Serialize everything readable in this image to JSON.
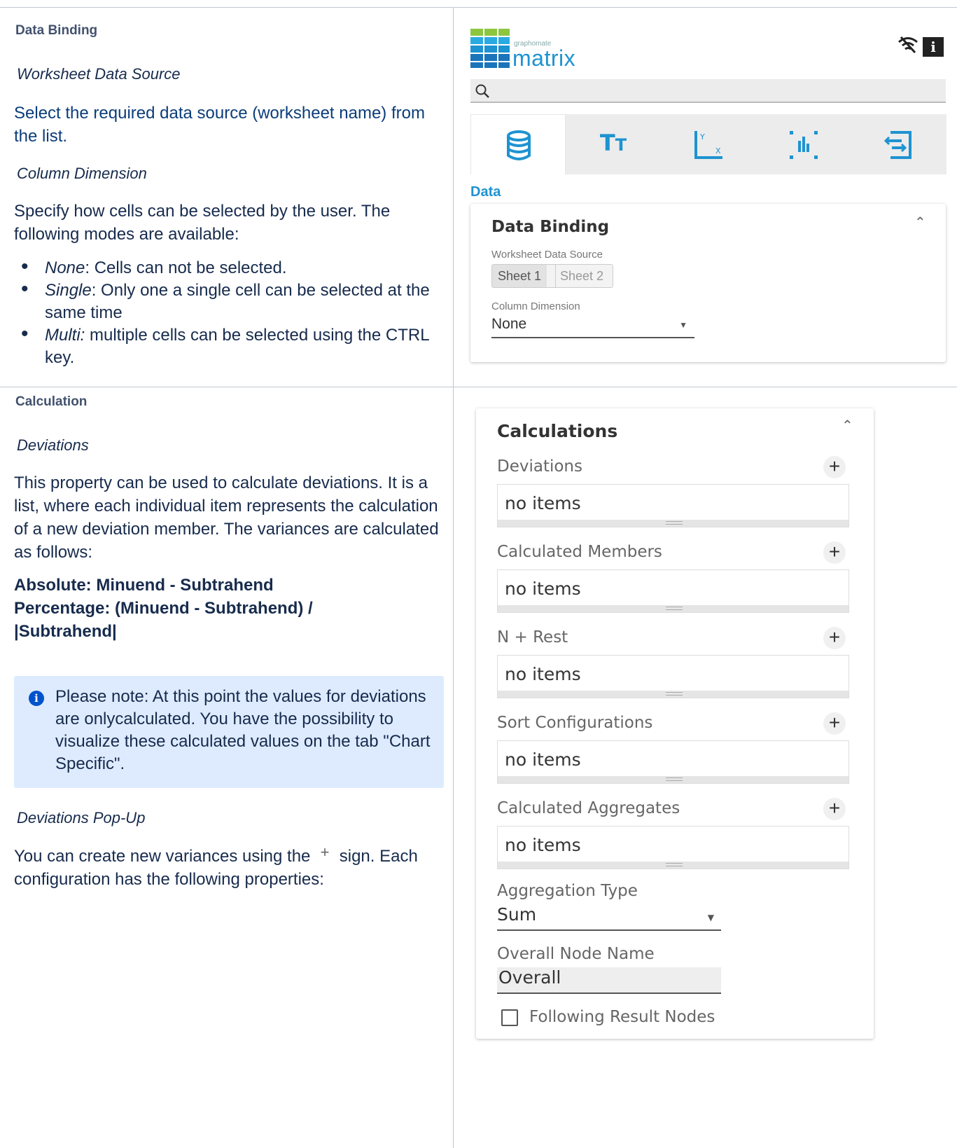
{
  "row1": {
    "left": {
      "header": "Data Binding",
      "sub1": "Worksheet Data Source",
      "para1": "Select the required data source (worksheet name) from the list.",
      "sub2": "Column Dimension",
      "para2": "Specify how cells can be selected by the user. The following modes are available:",
      "bullets": [
        {
          "term": "None",
          "sep": ":",
          "text": " Cells can not be selected."
        },
        {
          "term": "Single",
          "sep": ":",
          "text": " Only one a single cell can be selected at the same time"
        },
        {
          "term": "Multi:",
          "sep": "",
          "text": " multiple cells can be selected using the CTRL key."
        }
      ]
    },
    "right": {
      "logo_small": "graphomate",
      "logo_word": "matrix",
      "search_placeholder": "",
      "tabs": [
        {
          "icon": "database-icon",
          "glyph": "⛁"
        },
        {
          "icon": "text-size-icon",
          "glyph": "Tᴛ"
        },
        {
          "icon": "axis-icon",
          "glyph": ""
        },
        {
          "icon": "chart-bars-icon",
          "glyph": ""
        },
        {
          "icon": "export-icon",
          "glyph": ""
        }
      ],
      "section": "Data",
      "card_title": "Data Binding",
      "worksheet_label": "Worksheet Data Source",
      "sheets": [
        "Sheet 1",
        "Sheet 2"
      ],
      "column_dim_label": "Column Dimension",
      "column_dim_value": "None"
    }
  },
  "row2": {
    "left": {
      "header": "Calculation",
      "sub1": "Deviations",
      "para1": "This property can be used to calculate deviations. It is a list, where each individual item represents the calculation of a new deviation member. The variances are calculated as follows:",
      "formula1": "Absolute: Minuend - Subtrahend",
      "formula2": "Percentage: (Minuend - Subtrahend) / |Subtrahend|",
      "note": "Please note: At this point the values for deviations are onlycalculated. You have the possibility to visualize these calculated values on the tab \"Chart Specific\".",
      "sub2": "Deviations Pop-Up",
      "para2a": "You can create new variances using the",
      "para2b": "sign. Each configuration has the following properties:"
    },
    "right": {
      "card_title": "Calculations",
      "lists": [
        {
          "label": "Deviations",
          "value": "no items"
        },
        {
          "label": "Calculated Members",
          "value": "no items"
        },
        {
          "label": "N + Rest",
          "value": "no items"
        },
        {
          "label": "Sort Configurations",
          "value": "no items"
        },
        {
          "label": "Calculated Aggregates",
          "value": "no items"
        }
      ],
      "aggregation_label": "Aggregation Type",
      "aggregation_value": "Sum",
      "overall_label": "Overall Node Name",
      "overall_value": "Overall",
      "following_label": "Following Result Nodes"
    }
  },
  "colors": {
    "accent": "#1e93d1",
    "info_panel": "#deebff",
    "info_icon": "#0052cc"
  }
}
